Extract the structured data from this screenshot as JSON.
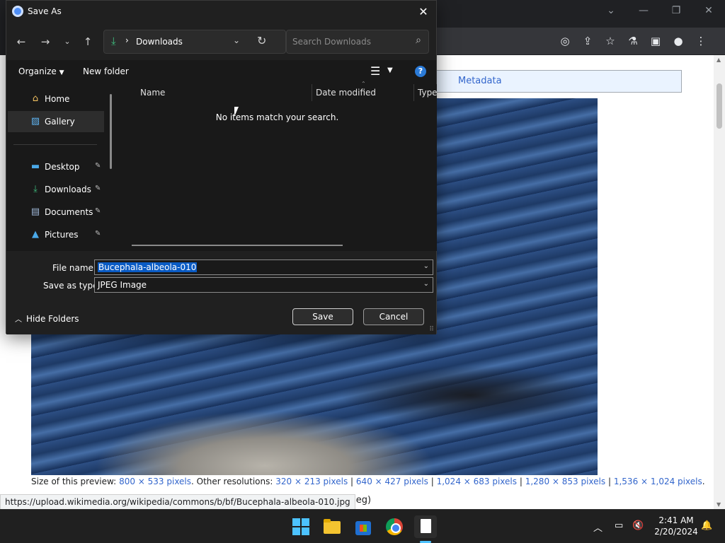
{
  "browser": {
    "tab_metadata": "Metadata",
    "caption": {
      "prefix": "Size of this preview:",
      "preview": "800 × 533 pixels",
      "other_label": ". Other resolutions:",
      "res1": "320 × 213 pixels",
      "res2": "640 × 427 pixels",
      "res3": "1,024 × 683 pixels",
      "res4": "1,280 × 853 pixels",
      "res5": "1,536 × 1,024 pixels",
      "sep": "|",
      "end": "."
    },
    "file_meta_fragment": "image/jpeg)",
    "status_url": "https://upload.wikimedia.org/wikipedia/commons/b/bf/Bucephala-albeola-010.jpg"
  },
  "dialog": {
    "title": "Save As",
    "address": {
      "separator": "›",
      "crumb": "Downloads"
    },
    "search_placeholder": "Search Downloads",
    "commands": {
      "organize": "Organize",
      "new_folder": "New folder",
      "help": "?"
    },
    "nav_items": [
      {
        "label": "Home",
        "icon": "home-icon"
      },
      {
        "label": "Gallery",
        "icon": "gallery-icon"
      },
      {
        "label": "Desktop",
        "icon": "desktop-icon"
      },
      {
        "label": "Downloads",
        "icon": "download-icon"
      },
      {
        "label": "Documents",
        "icon": "documents-icon"
      },
      {
        "label": "Pictures",
        "icon": "pictures-icon"
      }
    ],
    "columns": {
      "name": "Name",
      "date_modified": "Date modified",
      "type": "Type"
    },
    "empty_message": "No items match your search.",
    "file_name_label": "File name:",
    "file_name_value": "Bucephala-albeola-010",
    "save_type_label": "Save as type:",
    "save_type_value": "JPEG Image",
    "hide_folders": "Hide Folders",
    "save": "Save",
    "cancel": "Cancel"
  },
  "taskbar": {
    "time": "2:41 AM",
    "date": "2/20/2024"
  },
  "colors": {
    "dialog_bg": "#191919",
    "accent": "#0a5bc4",
    "link": "#3366cc"
  }
}
